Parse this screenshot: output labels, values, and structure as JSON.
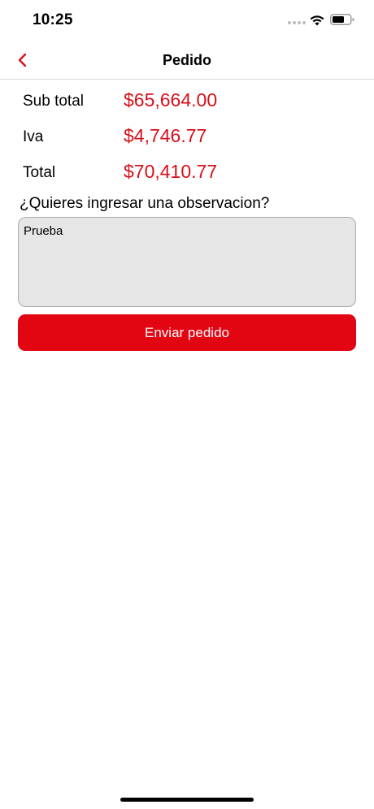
{
  "status_bar": {
    "time": "10:25"
  },
  "nav": {
    "title": "Pedido",
    "back_icon": "chevron-left-icon"
  },
  "totals": [
    {
      "label": "Sub total",
      "value": "$65,664.00"
    },
    {
      "label": "Iva",
      "value": "$4,746.77"
    },
    {
      "label": "Total",
      "value": "$70,410.77"
    }
  ],
  "observation": {
    "question": "¿Quieres ingresar una observacion?",
    "value": "Prueba"
  },
  "actions": {
    "send_label": "Enviar pedido"
  },
  "colors": {
    "accent": "#e20613",
    "amount": "#d8101a",
    "textarea_bg": "#e6e6e6"
  }
}
